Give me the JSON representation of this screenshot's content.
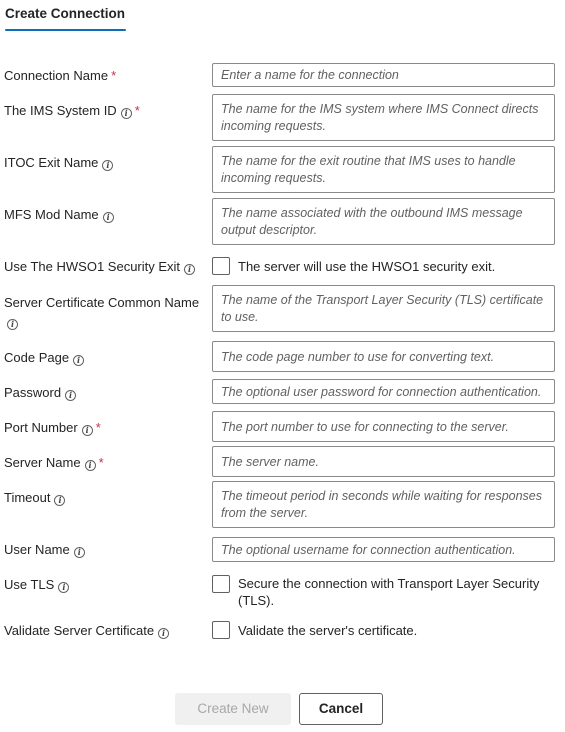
{
  "header": {
    "tab_label": "Create Connection"
  },
  "fields": {
    "connection_name": {
      "label": "Connection Name",
      "placeholder": "Enter a name for the connection"
    },
    "ims_system_id": {
      "label": "The IMS System ID",
      "placeholder": "The name for the IMS system where IMS Connect directs incoming requests."
    },
    "itoc_exit_name": {
      "label": "ITOC Exit Name",
      "placeholder": "The name for the exit routine that IMS uses to handle incoming requests."
    },
    "mfs_mod_name": {
      "label": "MFS Mod Name",
      "placeholder": "The name associated with the outbound IMS message output descriptor."
    },
    "hwso1_security_exit": {
      "label": "Use The HWSO1 Security Exit",
      "text": "The server will use the HWSO1 security exit."
    },
    "server_cert_common_name": {
      "label": "Server Certificate Common Name",
      "placeholder": "The name of the Transport Layer Security (TLS) certificate to use."
    },
    "code_page": {
      "label": "Code Page",
      "placeholder": "The code page number to use for converting text."
    },
    "password": {
      "label": "Password",
      "placeholder": "The optional user password for connection authentication."
    },
    "port_number": {
      "label": "Port Number",
      "placeholder": "The port number to use for connecting to the server."
    },
    "server_name": {
      "label": "Server Name",
      "placeholder": "The server name."
    },
    "timeout": {
      "label": "Timeout",
      "placeholder": "The timeout period in seconds while waiting for responses from the server."
    },
    "user_name": {
      "label": "User Name",
      "placeholder": "The optional username for connection authentication."
    },
    "use_tls": {
      "label": "Use TLS",
      "text": "Secure the connection with Transport Layer Security (TLS)."
    },
    "validate_server_cert": {
      "label": "Validate Server Certificate",
      "text": "Validate the server's certificate."
    }
  },
  "required_marker": "*",
  "info_glyph": "i",
  "buttons": {
    "create_label": "Create New",
    "cancel_label": "Cancel"
  },
  "colors": {
    "accent": "#0f6cbd",
    "required": "#c4314b"
  }
}
